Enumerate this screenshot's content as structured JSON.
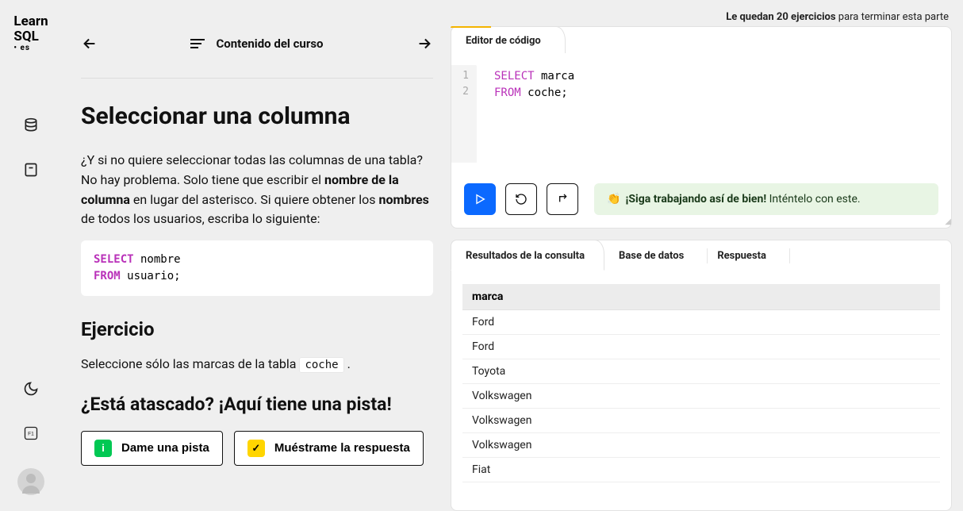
{
  "logo": {
    "line1": "Learn",
    "line2": "SQL",
    "line3": "• es"
  },
  "nav": {
    "title": "Contenido del curso"
  },
  "lesson": {
    "title": "Seleccionar una columna",
    "intro_a": "¿Y si no quiere seleccionar todas las columnas de una tabla? No hay problema. Solo tiene que escribir el ",
    "intro_b": "nombre de la columna",
    "intro_c": " en lugar del asterisco. Si quiere obtener los ",
    "intro_d": "nombres",
    "intro_e": " de todos los usuarios, escriba lo siguiente:",
    "example_kw1": "SELECT",
    "example_ident1": " nombre",
    "example_kw2": "FROM",
    "example_ident2": " usuario;",
    "exercise_heading": "Ejercicio",
    "exercise_text_a": "Seleccione sólo las marcas de la tabla ",
    "exercise_code": "coche",
    "exercise_text_b": " .",
    "hint_heading": "¿Está atascado? ¡Aquí tiene una pista!",
    "hint_btn": "Dame una pista",
    "answer_btn": "Muéstrame la respuesta"
  },
  "progress": {
    "bold": "Le quedan 20 ejercicios",
    "rest": " para terminar esta parte"
  },
  "editor": {
    "tab": "Editor de código",
    "line1_kw": "SELECT",
    "line1_rest": " marca",
    "line2_kw": "FROM",
    "line2_rest": " coche;",
    "gutter1": "1",
    "gutter2": "2",
    "feedback_emoji": "👏",
    "feedback_bold": "¡Siga trabajando así de bien!",
    "feedback_rest": " Inténtelo con este."
  },
  "results": {
    "tab_results": "Resultados de la consulta",
    "tab_db": "Base de datos",
    "tab_answer": "Respuesta",
    "header": "marca",
    "rows": [
      "Ford",
      "Ford",
      "Toyota",
      "Volkswagen",
      "Volkswagen",
      "Volkswagen",
      "Fiat"
    ]
  }
}
